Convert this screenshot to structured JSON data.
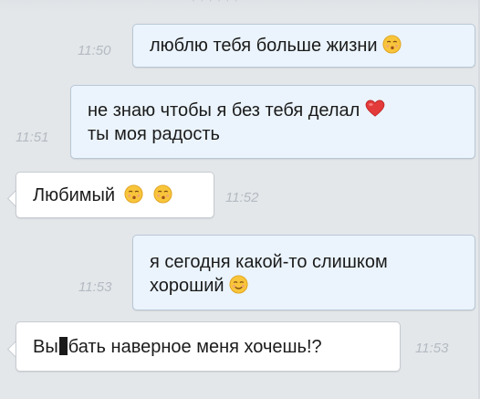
{
  "colors": {
    "background": "#e4e7ea",
    "outgoing_bubble": "#ebf4fc",
    "incoming_bubble": "#ffffff",
    "timestamp": "#b3bac2",
    "text": "#1b1b1b"
  },
  "header": {
    "partial_text": "· · · · · ·"
  },
  "messages": [
    {
      "direction": "outgoing",
      "time": "11:50",
      "lines": [
        "люблю тебя больше жизни"
      ],
      "emoji": [
        "kissing-face-icon"
      ]
    },
    {
      "direction": "outgoing",
      "time": "11:51",
      "lines": [
        "не знаю чтобы я без тебя делал",
        "ты моя радость"
      ],
      "emoji": [
        "heart-icon"
      ]
    },
    {
      "direction": "incoming",
      "time": "11:52",
      "lines": [
        "Любимый"
      ],
      "emoji": [
        "kissing-face-icon",
        "kissing-face-icon"
      ]
    },
    {
      "direction": "outgoing",
      "time": "11:53",
      "lines": [
        "я сегодня какой-то слишком",
        "хороший"
      ],
      "emoji": [
        "smiling-face-icon"
      ]
    },
    {
      "direction": "incoming",
      "time": "11:53",
      "text_before_censor": "Вы",
      "text_after_censor": "бать наверное меня хочешь!?",
      "emoji": []
    }
  ]
}
